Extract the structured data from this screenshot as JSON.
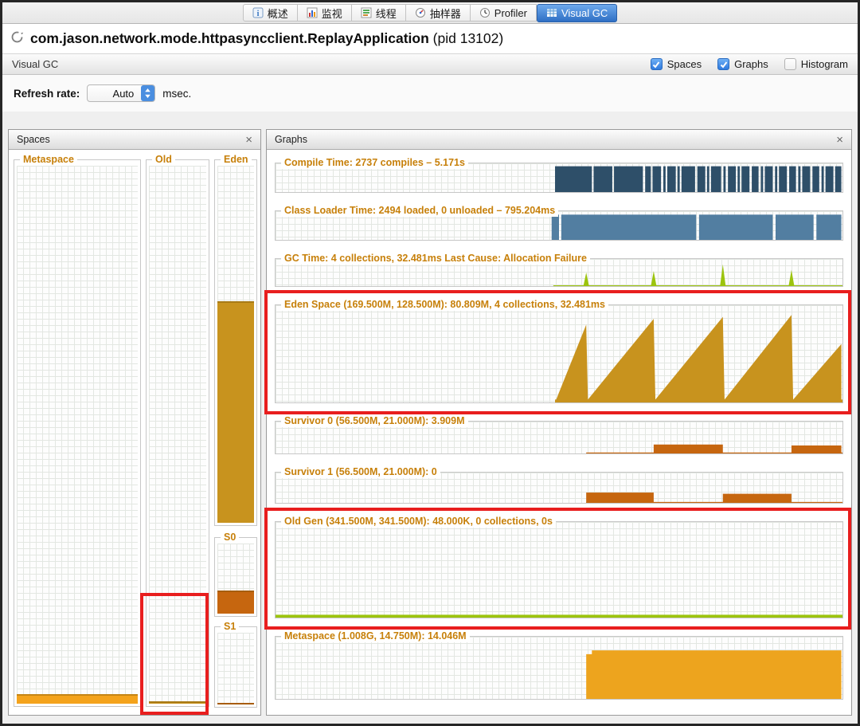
{
  "tabbar": {
    "tabs": [
      {
        "label": "概述",
        "icon": "overview-icon",
        "active": false
      },
      {
        "label": "监视",
        "icon": "monitor-icon",
        "active": false
      },
      {
        "label": "线程",
        "icon": "threads-icon",
        "active": false
      },
      {
        "label": "抽样器",
        "icon": "sampler-icon",
        "active": false
      },
      {
        "label": "Profiler",
        "icon": "profiler-icon",
        "active": false
      },
      {
        "label": "Visual GC",
        "icon": "visualgc-icon",
        "active": true
      }
    ]
  },
  "header": {
    "app_class": "com.jason.network.mode.httpasyncclient.ReplayApplication",
    "pid": "(pid 13102)"
  },
  "toolbar": {
    "title": "Visual GC",
    "checkboxes": [
      {
        "label": "Spaces",
        "checked": true
      },
      {
        "label": "Graphs",
        "checked": true
      },
      {
        "label": "Histogram",
        "checked": false
      }
    ]
  },
  "refresh": {
    "label": "Refresh rate:",
    "value": "Auto",
    "unit": "msec."
  },
  "spaces_panel": {
    "title": "Spaces",
    "close_label": "×",
    "columns": [
      {
        "label": "Metaspace",
        "fill_percent": 1.8,
        "fill_color": "#f4a31c"
      },
      {
        "label": "Old",
        "fill_percent": 0.5,
        "fill_color": "#c8931e"
      },
      {
        "label": "Eden",
        "fill_percent": 62,
        "fill_color": "#c8931e"
      },
      {
        "label": "S0",
        "fill_percent": 33,
        "fill_color": "#c6660f"
      },
      {
        "label": "S1",
        "fill_percent": 0.8,
        "fill_color": "#c6660f"
      }
    ]
  },
  "graphs_panel": {
    "title": "Graphs",
    "close_label": "×",
    "graphs": [
      {
        "title": "Compile Time: 2737 compiles – 5.171s",
        "color": "#2e4f69",
        "shape": {
          "kind": "bars",
          "bars": [
            [
              0.493,
              0.558,
              0.9
            ],
            [
              0.561,
              0.594,
              0.9
            ],
            [
              0.597,
              0.648,
              0.9
            ],
            [
              0.652,
              0.662,
              0.9
            ],
            [
              0.665,
              0.68,
              0.9
            ],
            [
              0.684,
              0.688,
              0.9
            ],
            [
              0.691,
              0.706,
              0.9
            ],
            [
              0.709,
              0.713,
              0.9
            ],
            [
              0.716,
              0.74,
              0.9
            ],
            [
              0.744,
              0.758,
              0.9
            ],
            [
              0.761,
              0.765,
              0.9
            ],
            [
              0.768,
              0.786,
              0.9
            ],
            [
              0.79,
              0.794,
              0.9
            ],
            [
              0.798,
              0.812,
              0.9
            ],
            [
              0.815,
              0.819,
              0.9
            ],
            [
              0.822,
              0.836,
              0.9
            ],
            [
              0.84,
              0.852,
              0.9
            ],
            [
              0.856,
              0.86,
              0.9
            ],
            [
              0.863,
              0.877,
              0.9
            ],
            [
              0.881,
              0.885,
              0.9
            ],
            [
              0.888,
              0.902,
              0.9
            ],
            [
              0.906,
              0.918,
              0.9
            ],
            [
              0.922,
              0.926,
              0.9
            ],
            [
              0.929,
              0.943,
              0.9
            ],
            [
              0.947,
              0.959,
              0.9
            ],
            [
              0.963,
              0.967,
              0.9
            ],
            [
              0.97,
              0.984,
              0.9
            ],
            [
              0.987,
              0.998,
              0.9
            ]
          ]
        }
      },
      {
        "title": "Class Loader Time: 2494 loaded, 0 unloaded – 795.204ms",
        "color": "#527ea1",
        "shape": {
          "kind": "bars",
          "bars": [
            [
              0.487,
              0.5,
              0.88
            ],
            [
              0.504,
              0.742,
              0.88
            ],
            [
              0.747,
              0.877,
              0.88
            ],
            [
              0.882,
              0.949,
              0.88
            ],
            [
              0.954,
              0.998,
              0.88
            ]
          ]
        }
      },
      {
        "title": "GC Time: 4 collections, 32.481ms Last Cause: Allocation Failure",
        "color": "#9cc40e",
        "shape": {
          "kind": "spikes",
          "spikes": [
            {
              "x": 0.548,
              "h": 0.5
            },
            {
              "x": 0.667,
              "h": 0.55
            },
            {
              "x": 0.789,
              "h": 0.8
            },
            {
              "x": 0.91,
              "h": 0.6
            }
          ],
          "baseline": [
            0.49,
            1.0
          ]
        }
      },
      {
        "title": "Eden Space (169.500M, 128.500M): 80.809M, 4 collections, 32.481ms",
        "color": "#c8931e",
        "shape": {
          "kind": "polygon",
          "points": [
            [
              0.493,
              0
            ],
            [
              0.548,
              0.8
            ],
            [
              0.551,
              0.03
            ],
            [
              0.667,
              0.86
            ],
            [
              0.67,
              0.03
            ],
            [
              0.789,
              0.88
            ],
            [
              0.792,
              0.03
            ],
            [
              0.91,
              0.9
            ],
            [
              0.913,
              0.03
            ],
            [
              0.998,
              0.6
            ]
          ],
          "baseline": [
            0.493,
            1.0
          ]
        }
      },
      {
        "title": "Survivor 0 (56.500M, 21.000M): 3.909M",
        "color": "#c6660f",
        "shape": {
          "kind": "bars",
          "bars": [
            [
              0.667,
              0.789,
              0.28
            ],
            [
              0.91,
              0.998,
              0.25
            ]
          ],
          "baseline": [
            0.548,
            1.0
          ]
        }
      },
      {
        "title": "Survivor 1 (56.500M, 21.000M): 0",
        "color": "#c6660f",
        "shape": {
          "kind": "bars",
          "bars": [
            [
              0.548,
              0.667,
              0.34
            ],
            [
              0.789,
              0.91,
              0.3
            ]
          ],
          "baseline": [
            0.548,
            1.0
          ]
        }
      },
      {
        "title": "Old Gen (341.500M, 341.500M): 48.000K, 0 collections, 0s",
        "color": "#c8931e",
        "shape": {
          "kind": "bars",
          "bars": [],
          "baseline": [
            0.0,
            1.0
          ],
          "baseline_color": "#9cc40e"
        }
      },
      {
        "title": "Metaspace (1.008G, 14.750M): 14.046M",
        "color": "#eda41e",
        "shape": {
          "kind": "polygon",
          "points": [
            [
              0.548,
              0
            ],
            [
              0.548,
              0.72
            ],
            [
              0.558,
              0.72
            ],
            [
              0.558,
              0.78
            ],
            [
              0.998,
              0.78
            ]
          ]
        }
      }
    ]
  },
  "annotations": {
    "highlight_color": "#e81e1e"
  },
  "colors": {
    "tab_active": "#2e6fc4",
    "group_title_orange": "#c7800a",
    "grid_line": "#e3e7e2"
  }
}
